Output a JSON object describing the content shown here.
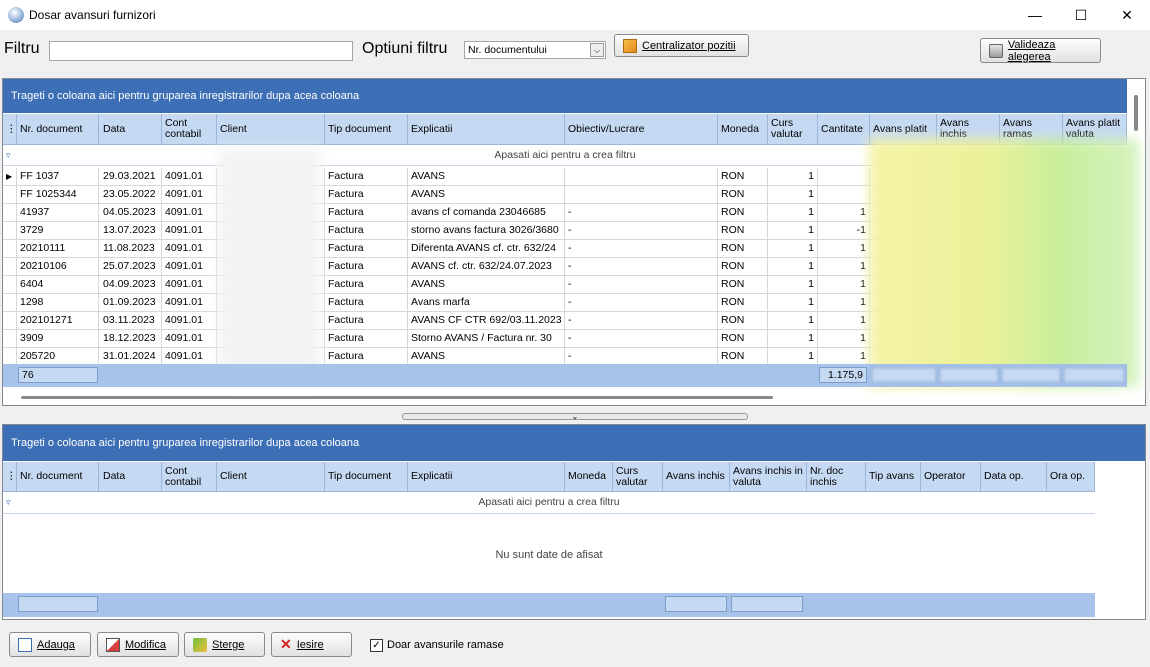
{
  "window": {
    "title": "Dosar avansuri furnizori",
    "controls": {
      "minimize": "—",
      "maximize": "☐",
      "close": "✕"
    }
  },
  "toolbar": {
    "filter_label": "Filtru",
    "filter_value": "",
    "options_label": "Optiuni filtru",
    "options_selected": "Nr. documentului",
    "centralizer_label": "Centralizator pozitii",
    "validate_label": "Valideaza alegerea"
  },
  "upper_grid": {
    "group_hint": "Trageti o coloana aici pentru gruparea inregistrarilor dupa acea coloana",
    "filter_hint": "Apasati aici pentru a  crea filtru",
    "columns": [
      "Nr. document",
      "Data",
      "Cont contabil",
      "Client",
      "Tip document",
      "Explicatii",
      "Obiectiv/Lucrare",
      "Moneda",
      "Curs valutar",
      "Cantitate",
      "Avans platit",
      "Avans inchis",
      "Avans ramas",
      "Avans  platit valuta"
    ],
    "rows": [
      {
        "nr": "FF 1037",
        "data": "29.03.2021",
        "cont": "4091.01",
        "client": "",
        "tip": "Factura",
        "expl": "AVANS",
        "obiectiv": "",
        "moneda": "RON",
        "curs": "1",
        "cant": ""
      },
      {
        "nr": "FF 1025344",
        "data": "23.05.2022",
        "cont": "4091.01",
        "client": "",
        "tip": "Factura",
        "expl": "AVANS",
        "obiectiv": "",
        "moneda": "RON",
        "curs": "1",
        "cant": ""
      },
      {
        "nr": "41937",
        "data": "04.05.2023",
        "cont": "4091.01",
        "client": "",
        "tip": "Factura",
        "expl": "avans cf comanda 23046685",
        "obiectiv": "-",
        "moneda": "RON",
        "curs": "1",
        "cant": "1"
      },
      {
        "nr": "3729",
        "data": "13.07.2023",
        "cont": "4091.01",
        "client": "",
        "tip": "Factura",
        "expl": "storno avans factura 3026/3680",
        "obiectiv": "-",
        "moneda": "RON",
        "curs": "1",
        "cant": "-1"
      },
      {
        "nr": "20210111",
        "data": "11.08.2023",
        "cont": "4091.01",
        "client": "",
        "tip": "Factura",
        "expl": "Diferenta AVANS cf. ctr. 632/24",
        "obiectiv": "-",
        "moneda": "RON",
        "curs": "1",
        "cant": "1"
      },
      {
        "nr": "20210106",
        "data": "25.07.2023",
        "cont": "4091.01",
        "client": "",
        "tip": "Factura",
        "expl": "AVANS cf. ctr. 632/24.07.2023",
        "obiectiv": "-",
        "moneda": "RON",
        "curs": "1",
        "cant": "1"
      },
      {
        "nr": "6404",
        "data": "04.09.2023",
        "cont": "4091.01",
        "client": "",
        "tip": "Factura",
        "expl": "AVANS",
        "obiectiv": "-",
        "moneda": "RON",
        "curs": "1",
        "cant": "1"
      },
      {
        "nr": "1298",
        "data": "01.09.2023",
        "cont": "4091.01",
        "client": "",
        "tip": "Factura",
        "expl": "Avans marfa",
        "obiectiv": "-",
        "moneda": "RON",
        "curs": "1",
        "cant": "1"
      },
      {
        "nr": "202101271",
        "data": "03.11.2023",
        "cont": "4091.01",
        "client": "",
        "tip": "Factura",
        "expl": "AVANS CF CTR 692/03.11.2023",
        "obiectiv": "-",
        "moneda": "RON",
        "curs": "1",
        "cant": "1"
      },
      {
        "nr": "3909",
        "data": "18.12.2023",
        "cont": "4091.01",
        "client": "",
        "tip": "Factura",
        "expl": "Storno AVANS / Factura nr.  30",
        "obiectiv": "-",
        "moneda": "RON",
        "curs": "1",
        "cant": "1"
      },
      {
        "nr": "205720",
        "data": "31.01.2024",
        "cont": "4091.01",
        "client": "",
        "tip": "Factura",
        "expl": "AVANS",
        "obiectiv": "-",
        "moneda": "RON",
        "curs": "1",
        "cant": "1"
      }
    ],
    "footer_count": "76",
    "footer_cantitate": "1.175,9"
  },
  "lower_grid": {
    "group_hint": "Trageti o coloana aici pentru gruparea inregistrarilor dupa acea coloana",
    "filter_hint": "Apasati aici pentru a  crea filtru",
    "columns": [
      "Nr. document",
      "Data",
      "Cont contabil",
      "Client",
      "Tip document",
      "Explicatii",
      "Moneda",
      "Curs valutar",
      "Avans inchis",
      "Avans inchis in valuta",
      "Nr. doc inchis",
      "Tip avans",
      "Operator",
      "Data op.",
      "Ora op."
    ],
    "empty_text": "Nu sunt date de afisat"
  },
  "bottom": {
    "add_label": "Adauga",
    "edit_label": "Modifica",
    "delete_label": "Sterge",
    "exit_label": "Iesire",
    "checkbox_label": "Doar avansurile ramase",
    "checkbox_checked": true
  }
}
